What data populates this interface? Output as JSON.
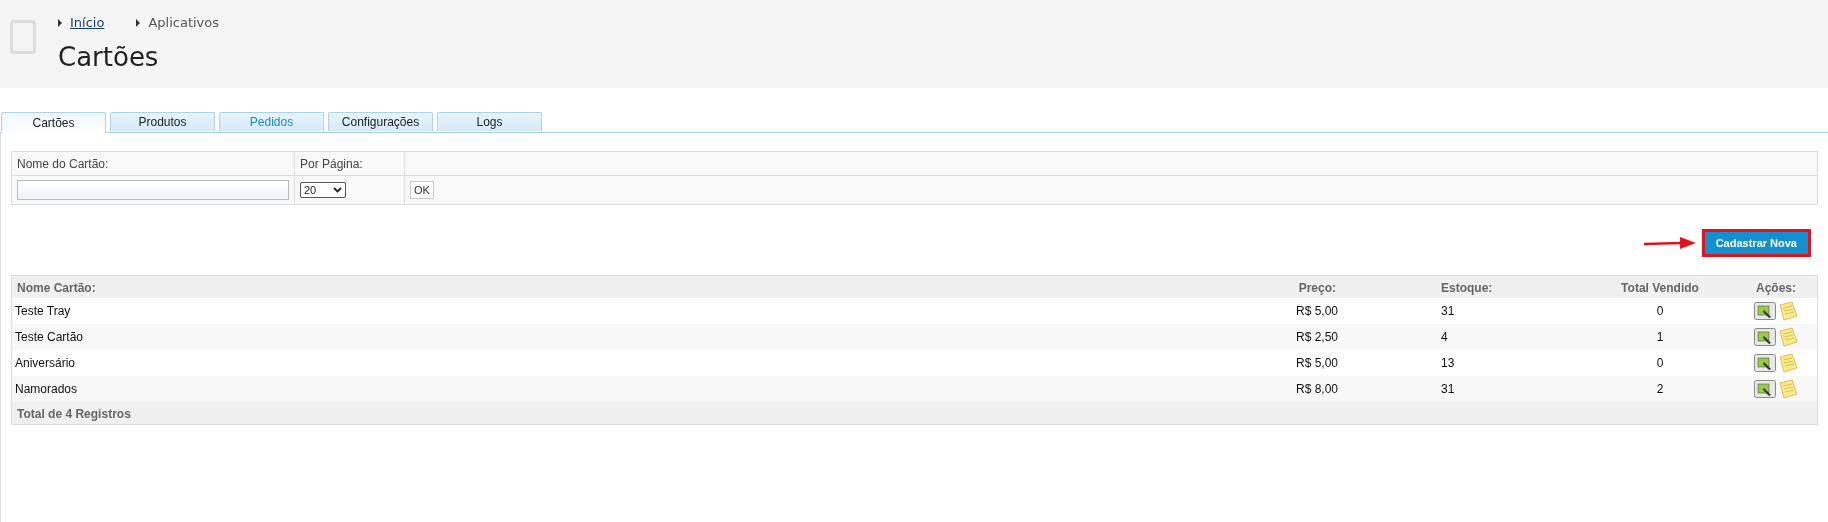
{
  "breadcrumb": [
    {
      "label": "Início",
      "link": true
    },
    {
      "label": "Aplicativos",
      "link": false
    }
  ],
  "title": "Cartões",
  "tabs": [
    {
      "label": "Cartões",
      "selected": true,
      "hovered": false
    },
    {
      "label": "Produtos",
      "selected": false,
      "hovered": false
    },
    {
      "label": "Pedidos",
      "selected": false,
      "hovered": true
    },
    {
      "label": "Configurações",
      "selected": false,
      "hovered": false
    },
    {
      "label": "Logs",
      "selected": false,
      "hovered": false
    }
  ],
  "filter": {
    "name_label": "Nome do Cartão:",
    "per_page_label": "Por Página:",
    "per_page_value": "20",
    "ok_button": "OK"
  },
  "new_button": "Cadastrar Nova",
  "table": {
    "columns": [
      "Nome Cartão:",
      "Preço:",
      "Estoque:",
      "Total Vendido",
      "Ações:"
    ],
    "rows": [
      {
        "name": "Teste Tray",
        "price": "R$ 5,00",
        "stock": "31",
        "sold": "0"
      },
      {
        "name": "Teste Cartão",
        "price": "R$ 2,50",
        "stock": "4",
        "sold": "1"
      },
      {
        "name": "Aniversário",
        "price": "R$ 5,00",
        "stock": "13",
        "sold": "0"
      },
      {
        "name": "Namorados",
        "price": "R$ 8,00",
        "stock": "31",
        "sold": "2"
      }
    ],
    "footer": "Total de 4 Registros"
  }
}
